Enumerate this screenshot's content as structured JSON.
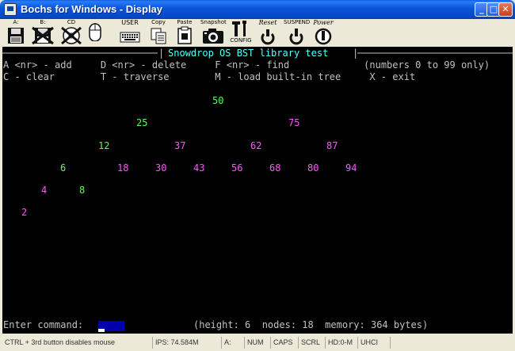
{
  "window": {
    "title": "Bochs for Windows - Display",
    "min_glyph": "_",
    "max_glyph": "□",
    "close_glyph": "✕"
  },
  "toolbar": {
    "floppy_a_label": "A:",
    "floppy_b_label": "B:",
    "cdrom_label": "CD",
    "mouse_label": "",
    "user_label": "USER",
    "copy_label": "Copy",
    "paste_label": "Paste",
    "snapshot_label": "Snapshot",
    "config_label": "CONFIG",
    "reset_label": "Reset",
    "suspend_label": "SUSPEND",
    "power_label": "Power"
  },
  "console": {
    "header_title": "Snowdrop OS BST library test",
    "header_left_bar": "|",
    "header_right_bar": "|",
    "menu_line1": "A <nr> - add     D <nr> - delete     F <nr> - find             (numbers 0 to 99 only)",
    "menu_line2": "C - clear        T - traverse        M - load built-in tree     X - exit",
    "tree_nodes": [
      {
        "value": "50",
        "color": "green"
      },
      {
        "value": "25",
        "color": "green"
      },
      {
        "value": "75",
        "color": "magenta"
      },
      {
        "value": "12",
        "color": "green"
      },
      {
        "value": "37",
        "color": "magenta"
      },
      {
        "value": "62",
        "color": "magenta"
      },
      {
        "value": "87",
        "color": "magenta"
      },
      {
        "value": "6",
        "color": "green"
      },
      {
        "value": "18",
        "color": "magenta"
      },
      {
        "value": "30",
        "color": "magenta"
      },
      {
        "value": "43",
        "color": "magenta"
      },
      {
        "value": "56",
        "color": "magenta"
      },
      {
        "value": "68",
        "color": "magenta"
      },
      {
        "value": "80",
        "color": "magenta"
      },
      {
        "value": "94",
        "color": "magenta"
      },
      {
        "value": "4",
        "color": "magenta"
      },
      {
        "value": "8",
        "color": "green"
      },
      {
        "value": "2",
        "color": "magenta"
      }
    ],
    "prompt": "Enter command:",
    "command_value": "",
    "stats": "(height: 6  nodes: 18  memory: 364 bytes)"
  },
  "statusbar": {
    "hint": "CTRL + 3rd button disables mouse",
    "ips": "IPS: 74.584M",
    "drive": "A:",
    "num": "NUM",
    "caps": "CAPS",
    "scrl": "SCRL",
    "hd": "HD:0-M",
    "uhci": "UHCI"
  },
  "colors": {
    "titlebar": "#0548c8",
    "screen_bg": "#000000",
    "node_green": "#55ff55",
    "node_magenta": "#ff55ff",
    "header_title": "#55ffff",
    "command_box": "#0000aa"
  }
}
